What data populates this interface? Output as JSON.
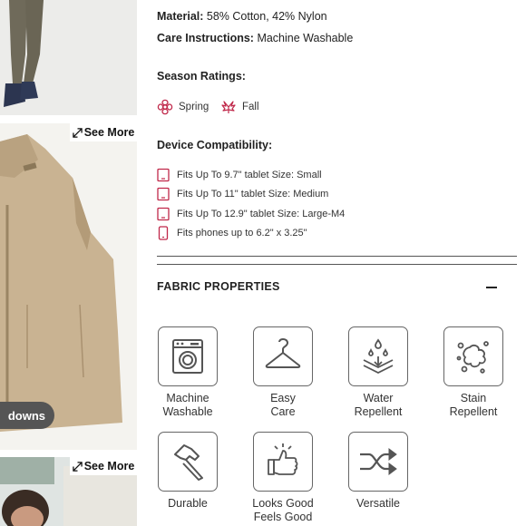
{
  "gallery": {
    "see_more_label": "See More",
    "pill_label": "downs"
  },
  "specs": {
    "material_label": "Material:",
    "material_value": " 58% Cotton, 42% Nylon",
    "care_label": "Care Instructions:",
    "care_value": " Machine Washable"
  },
  "season": {
    "heading": "Season Ratings:",
    "items": [
      {
        "label": "Spring",
        "icon": "flower-icon"
      },
      {
        "label": "Fall",
        "icon": "leaf-icon"
      }
    ],
    "accent_color": "#c0284a"
  },
  "devices": {
    "heading": "Device Compatibility:",
    "items": [
      {
        "label": "Fits Up To 9.7\" tablet Size: Small",
        "icon": "tablet-icon"
      },
      {
        "label": "Fits Up To 11\" tablet Size: Medium",
        "icon": "tablet-icon"
      },
      {
        "label": "Fits Up To 12.9\" tablet Size: Large-M4",
        "icon": "tablet-icon"
      },
      {
        "label": "Fits phones up to 6.2\" x 3.25\"",
        "icon": "phone-icon"
      }
    ]
  },
  "fabric": {
    "title": "FABRIC PROPERTIES",
    "properties": [
      {
        "label": "Machine\nWashable",
        "icon": "washing-machine-icon"
      },
      {
        "label": "Easy\nCare",
        "icon": "hanger-icon"
      },
      {
        "label": "Water\nRepellent",
        "icon": "water-drops-icon"
      },
      {
        "label": "Stain\nRepellent",
        "icon": "stain-splash-icon"
      },
      {
        "label": "Durable",
        "icon": "hammer-icon"
      },
      {
        "label": "Looks Good\nFeels Good",
        "icon": "thumbs-up-icon"
      },
      {
        "label": "Versatile",
        "icon": "shuffle-icon"
      }
    ]
  }
}
